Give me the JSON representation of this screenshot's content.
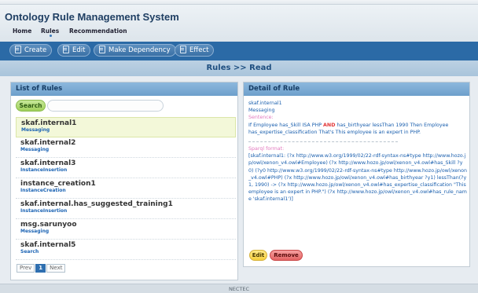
{
  "app": {
    "title": "Ontology Rule Management System"
  },
  "nav": {
    "items": [
      "Home",
      "Rules",
      "Recommendation"
    ]
  },
  "toolbar": {
    "buttons": [
      "Create",
      "Edit",
      "Make Dependency",
      "Effect"
    ]
  },
  "breadcrumb": "Rules >> Read",
  "list_panel": {
    "title": "List of Rules",
    "search_button": "Search",
    "search_value": "",
    "rules": [
      {
        "name": "skaf.internal1",
        "category": "Messaging",
        "selected": true
      },
      {
        "name": "skaf.internal2",
        "category": "Messaging"
      },
      {
        "name": "skaf.internal3",
        "category": "InstanceInsertion"
      },
      {
        "name": "instance_creation1",
        "category": "InstanceCreation"
      },
      {
        "name": "skaf.internal.has_suggested_training1",
        "category": "InstanceInsertion"
      },
      {
        "name": "msg.sarunyoo",
        "category": "Messaging"
      },
      {
        "name": "skaf.internal5",
        "category": "Search"
      }
    ],
    "pager": {
      "prev": "Prev",
      "page": "1",
      "next": "Next"
    }
  },
  "detail_panel": {
    "title": "Detail of Rule",
    "rule_name": "skaf.internal1",
    "rule_category": "Messaging",
    "sentence_label": "Sentence:",
    "sentence_before": "If Employee has_Skill ISA PHP ",
    "sentence_keyword": "AND",
    "sentence_after": " has_birthyear lessThan 1990 Then Employee has_expertise_classification That's This employee is an expert in PHP.",
    "sparql_label": "Sparql format:",
    "sparql": "[skaf.internal1: (?x http://www.w3.org/1999/02/22-rdf-syntax-ns#type http://www.hozo.jp/owl/xenon_v4.owl#Employee) (?x http://www.hozo.jp/owl/xenon_v4.owl#has_Skill ?y0) (?y0 http://www.w3.org/1999/02/22-rdf-syntax-ns#type http://www.hozo.jp/owl/xenon_v4.owl#PHP) (?x http://www.hozo.jp/owl/xenon_v4.owl#has_birthyear ?y1) lessThan(?y1, 1990) -> (?x http://www.hozo.jp/owl/xenon_v4.owl#has_expertise_classification \"This employee is an expert in PHP.\") (?x http://www.hozo.jp/owl/xenon_v4.owl#has_rule_name 'skaf.internal1')]",
    "edit_button": "Edit",
    "remove_button": "Remove"
  },
  "footer": "NECTEC"
}
